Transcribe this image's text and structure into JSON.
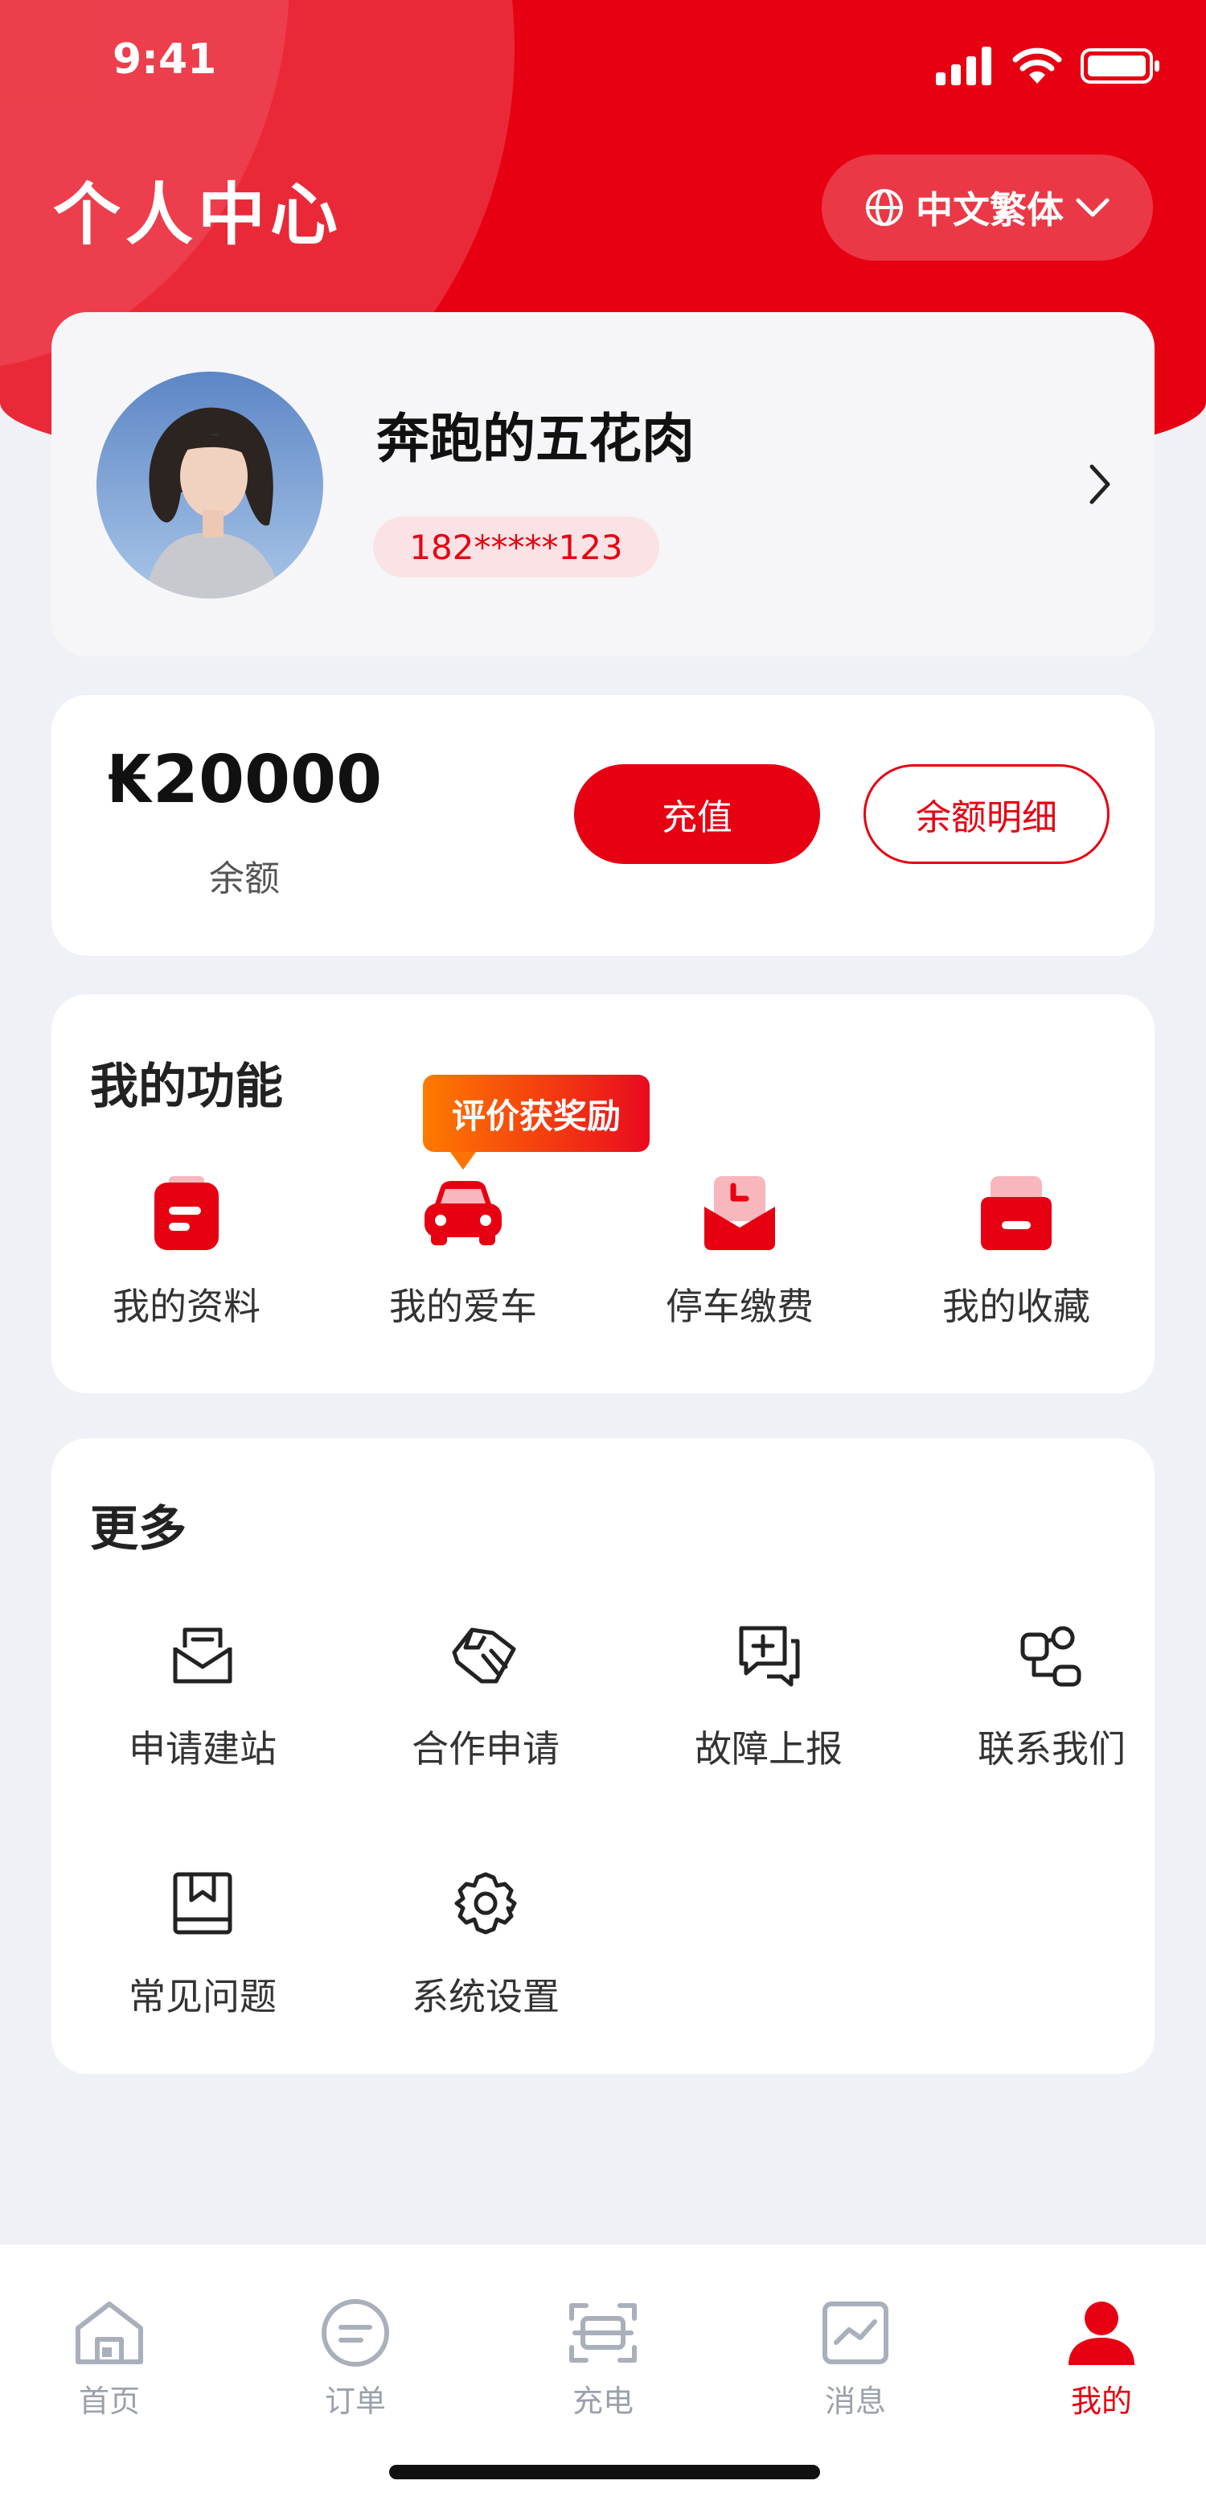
{
  "status_bar": {
    "time": "9:41"
  },
  "header": {
    "title": "个人中心",
    "language": {
      "label": "中文繁体",
      "icon": "globe-icon"
    }
  },
  "profile": {
    "nickname": "奔跑的五花肉",
    "phone": "182*****123"
  },
  "balance": {
    "amount": "₭20000",
    "label": "余额",
    "recharge_label": "充值",
    "detail_label": "余额明细"
  },
  "functions": {
    "title": "我的功能",
    "badge": "评价获奖励",
    "items": [
      {
        "label": "我的资料",
        "icon": "profile-doc-icon"
      },
      {
        "label": "我的爱车",
        "icon": "car-icon"
      },
      {
        "label": "停车缴费",
        "icon": "parking-envelope-icon"
      },
      {
        "label": "我的收藏",
        "icon": "favorites-box-icon"
      }
    ]
  },
  "more": {
    "title": "更多",
    "items": [
      {
        "label": "申请建站",
        "icon": "mail-icon"
      },
      {
        "label": "合作申请",
        "icon": "handshake-icon"
      },
      {
        "label": "故障上报",
        "icon": "report-chat-icon"
      },
      {
        "label": "联系我们",
        "icon": "contact-icon"
      },
      {
        "label": "常见问题",
        "icon": "bookmark-book-icon"
      },
      {
        "label": "系统设置",
        "icon": "settings-gear-icon"
      }
    ]
  },
  "tabs": [
    {
      "label": "首页",
      "icon": "home-icon"
    },
    {
      "label": "订单",
      "icon": "order-icon"
    },
    {
      "label": "充电",
      "icon": "charge-scan-icon"
    },
    {
      "label": "消息",
      "icon": "message-chart-icon"
    },
    {
      "label": "我的",
      "icon": "user-icon",
      "active": true
    }
  ],
  "colors": {
    "accent": "#e60012",
    "background": "#eff1f6",
    "inactive": "#9aa1ab"
  }
}
